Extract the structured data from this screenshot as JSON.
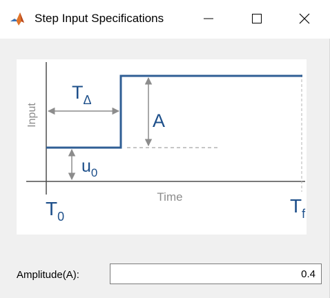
{
  "window": {
    "title": "Step Input Specifications",
    "icon": "matlab-icon"
  },
  "diagram": {
    "y_axis_label": "Input",
    "x_axis_label": "Time",
    "delay_label": "T",
    "delay_subscript": "Δ",
    "amplitude_label": "A",
    "initial_label": "u",
    "initial_subscript": "0",
    "start_label": "T",
    "start_subscript": "0",
    "final_label": "T",
    "final_subscript": "f",
    "colors": {
      "signal": "#2f5e94",
      "axis": "#4d4d4d",
      "annotation": "#8c8c8c",
      "label": "#1d4f8a"
    }
  },
  "fields": {
    "amplitude": {
      "label": "Amplitude(A):",
      "value": "0.4"
    }
  }
}
